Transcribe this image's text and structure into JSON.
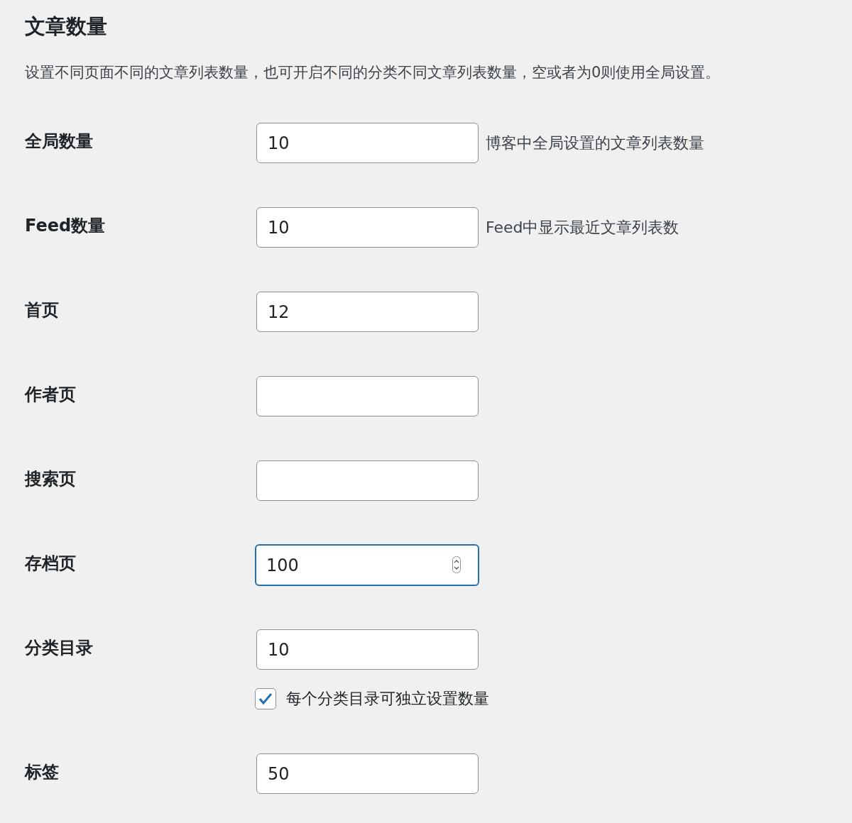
{
  "title": "文章数量",
  "description": "设置不同页面不同的文章列表数量，也可开启不同的分类不同文章列表数量，空或者为0则使用全局设置。",
  "fields": [
    {
      "label": "全局数量",
      "value": "10",
      "hint": "博客中全局设置的文章列表数量",
      "focused": false
    },
    {
      "label": "Feed数量",
      "value": "10",
      "hint": "Feed中显示最近文章列表数",
      "focused": false
    },
    {
      "label": "首页",
      "value": "12",
      "focused": false
    },
    {
      "label": "作者页",
      "focused": false
    },
    {
      "label": "搜索页",
      "focused": false
    },
    {
      "label": "存档页",
      "value": "100",
      "focused": true
    },
    {
      "label": "分类目录",
      "value": "10",
      "focused": false,
      "checkbox": {
        "label": "每个分类目录可独立设置数量",
        "checked": true
      }
    },
    {
      "label": "标签",
      "value": "50",
      "focused": false
    }
  ]
}
